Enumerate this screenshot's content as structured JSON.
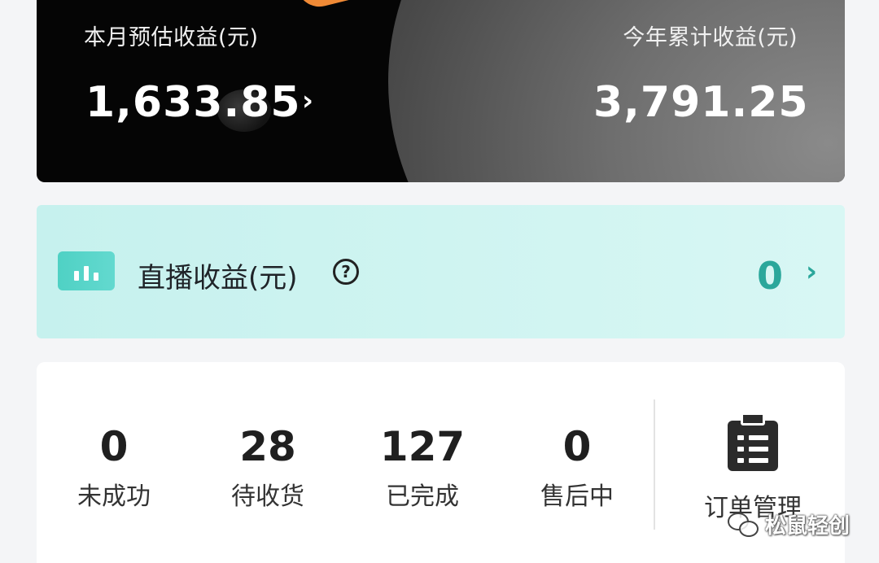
{
  "earnings": {
    "month_label": "本月预估收益(元)",
    "month_value": "1,633.85",
    "year_label": "今年累计收益(元)",
    "year_value": "3,791.25"
  },
  "live": {
    "label": "直播收益(元)",
    "help_glyph": "?",
    "value": "0",
    "chevron": "›"
  },
  "orders": {
    "stats": [
      {
        "value": "0",
        "label": "未成功"
      },
      {
        "value": "28",
        "label": "待收货"
      },
      {
        "value": "127",
        "label": "已完成"
      },
      {
        "value": "0",
        "label": "售后中"
      }
    ],
    "manage_label": "订单管理"
  },
  "watermark": {
    "text": "松鼠轻创"
  },
  "colors": {
    "teal_accent": "#2aa79b",
    "banner_bg": "#cff4f1",
    "card_dark": "#050505"
  },
  "icons": {
    "month_chevron": "chevron-right-icon",
    "live": "bar-chart-icon",
    "help": "question-circle-icon",
    "orders": "clipboard-icon",
    "watermark": "wechat-icon"
  }
}
